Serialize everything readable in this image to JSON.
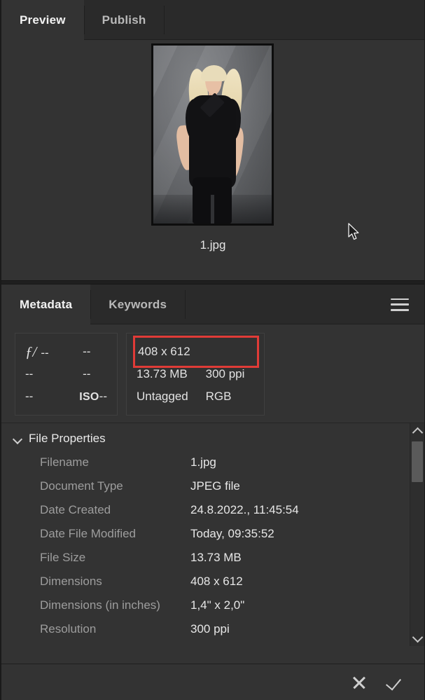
{
  "preview_panel": {
    "tabs": [
      {
        "label": "Preview",
        "active": true
      },
      {
        "label": "Publish",
        "active": false
      }
    ],
    "thumbnail_caption": "1.jpg",
    "thumbnail_alt": "portrait-photo-woman-black-shirt-gray-backdrop"
  },
  "metadata_panel": {
    "tabs": [
      {
        "label": "Metadata",
        "active": true
      },
      {
        "label": "Keywords",
        "active": false
      }
    ],
    "menu_icon": "hamburger-menu-icon",
    "exif_box": {
      "fstop_symbol": "ƒ/",
      "aperture": "--",
      "shutter_speed": "--",
      "exposure_bias": "--",
      "focal_length": "--",
      "flash": "--",
      "iso_label": "ISO",
      "iso_value": "--"
    },
    "info_box": {
      "dimensions": "408 x 612",
      "file_size": "13.73 MB",
      "resolution": "300 ppi",
      "color_profile": "Untagged",
      "color_mode": "RGB",
      "highlight_color": "#e03b37"
    },
    "section": {
      "title": "File Properties",
      "expanded": true,
      "rows": [
        {
          "label": "Filename",
          "value": "1.jpg"
        },
        {
          "label": "Document Type",
          "value": "JPEG file"
        },
        {
          "label": "Date Created",
          "value": "24.8.2022., 11:45:54"
        },
        {
          "label": "Date File Modified",
          "value": "Today, 09:35:52"
        },
        {
          "label": "File Size",
          "value": "13.73 MB"
        },
        {
          "label": "Dimensions",
          "value": "408 x 612"
        },
        {
          "label": "Dimensions (in inches)",
          "value": "1,4\" x 2,0\""
        },
        {
          "label": "Resolution",
          "value": "300 ppi"
        }
      ]
    },
    "scrollbar": {
      "up_icon": "chevron-up-icon",
      "down_icon": "chevron-down-icon"
    }
  },
  "bottom_bar": {
    "cancel_icon": "close-x-icon",
    "confirm_icon": "checkmark-icon"
  }
}
